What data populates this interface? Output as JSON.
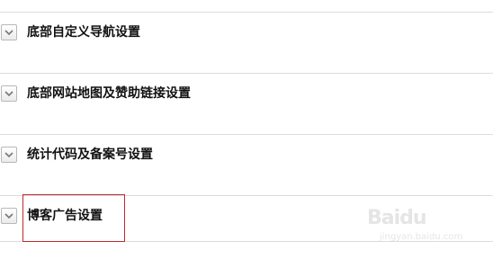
{
  "sections": [
    {
      "title": "底部自定义导航设置",
      "icon": "chevron-down-icon"
    },
    {
      "title": "底部网站地图及赞助链接设置",
      "icon": "chevron-down-icon"
    },
    {
      "title": "统计代码及备案号设置",
      "icon": "chevron-down-icon"
    },
    {
      "title": "博客广告设置",
      "icon": "chevron-down-icon"
    }
  ],
  "highlight": {
    "target": "博客广告设置",
    "color": "#c0292e"
  },
  "watermark": {
    "text": "Baidu",
    "sub": "jingyan.baidu.com"
  }
}
